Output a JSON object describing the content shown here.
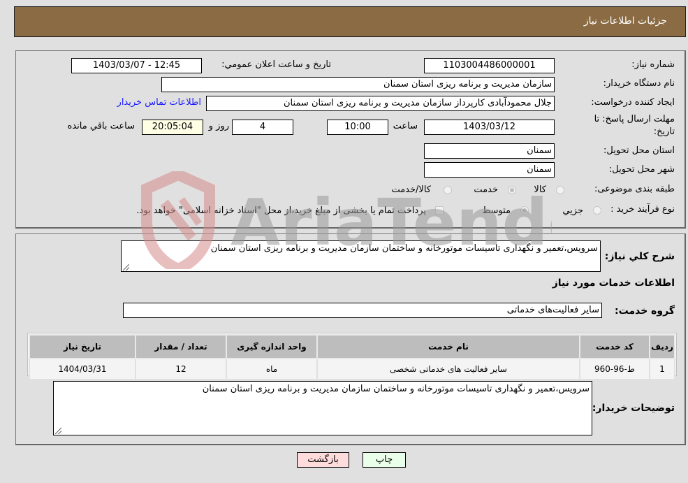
{
  "header": {
    "title": "جزئيات اطلاعات نياز"
  },
  "details": {
    "need_number_label": "شماره نياز:",
    "need_number": "1103004486000001",
    "announce_label": "تاريخ و ساعت اعلان عمومي:",
    "announce_value": "1403/03/07 - 12:45",
    "buyer_org_label": "نام دستگاه خريدار:",
    "buyer_org": "سازمان مدیریت و برنامه ریزی استان سمنان",
    "creator_label": "ايجاد کننده درخواست:",
    "creator": "جلال محمودآبادی کارپرداز سازمان مدیریت و برنامه ریزی استان سمنان",
    "buyer_contact_link": "اطلاعات تماس خريدار",
    "deadline_label_1": "مهلت ارسال پاسخ: تا",
    "deadline_label_2": "تاريخ:",
    "deadline_date": "1403/03/12",
    "time_label": "ساعت",
    "deadline_time": "10:00",
    "days_value": "4",
    "days_label": "روز و",
    "remaining_time": "20:05:04",
    "remaining_label": "ساعت باقي مانده",
    "province_label": "استان محل تحويل:",
    "province": "سمنان",
    "city_label": "شهر محل تحويل:",
    "city": "سمنان",
    "category_label": "طبقه بندی موضوعی:",
    "category_options": [
      {
        "label": "کالا",
        "selected": false
      },
      {
        "label": "خدمت",
        "selected": true
      },
      {
        "label": "کالا/خدمت",
        "selected": false
      }
    ],
    "process_label": "نوع فرآيند خريد :",
    "process_options": [
      {
        "label": "جزيي",
        "selected": false
      },
      {
        "label": "متوسط",
        "selected": true
      }
    ],
    "treasury_checkbox_label": "پرداخت تمام يا بخشی از مبلغ خريد،از محل \"اسناد خزانه اسلامی\" خواهد بود.",
    "treasury_checked": false
  },
  "services": {
    "summary_label": "شرح کلي نياز:",
    "summary": "سرویس،تعمیر و نگهداری تاسیسات موتورخانه و ساختمان سازمان مدیریت و برنامه ریزی استان سمنان",
    "section_title": "اطلاعات خدمات مورد نياز",
    "group_label": "گروه خدمت:",
    "group_value": "ساير فعاليت‌هاى خدماتى",
    "table": {
      "headers": [
        "رديف",
        "کد خدمت",
        "نام خدمت",
        "واحد اندازه گيری",
        "تعداد / مقدار",
        "تاريخ نياز"
      ],
      "rows": [
        [
          "1",
          "ط-96-960",
          "ساير فعاليت هاى خدماتى شخصى",
          "ماه",
          "12",
          "1404/03/31"
        ]
      ]
    },
    "buyer_notes_label": "توضيحات خريدار:",
    "buyer_notes": "سرویس،تعمیر و نگهداری تاسیسات موتورخانه و ساختمان سازمان مدیریت و برنامه ریزی استان سمنان"
  },
  "buttons": {
    "print": "چاپ",
    "back": "بازگشت"
  },
  "watermark": {
    "text": "AriaTender.neT"
  },
  "colors": {
    "header_bg": "#8b6b43",
    "print_btn_bg": "#eaffea",
    "back_btn_bg": "#ffdcdc",
    "link": "#1a1aff"
  }
}
